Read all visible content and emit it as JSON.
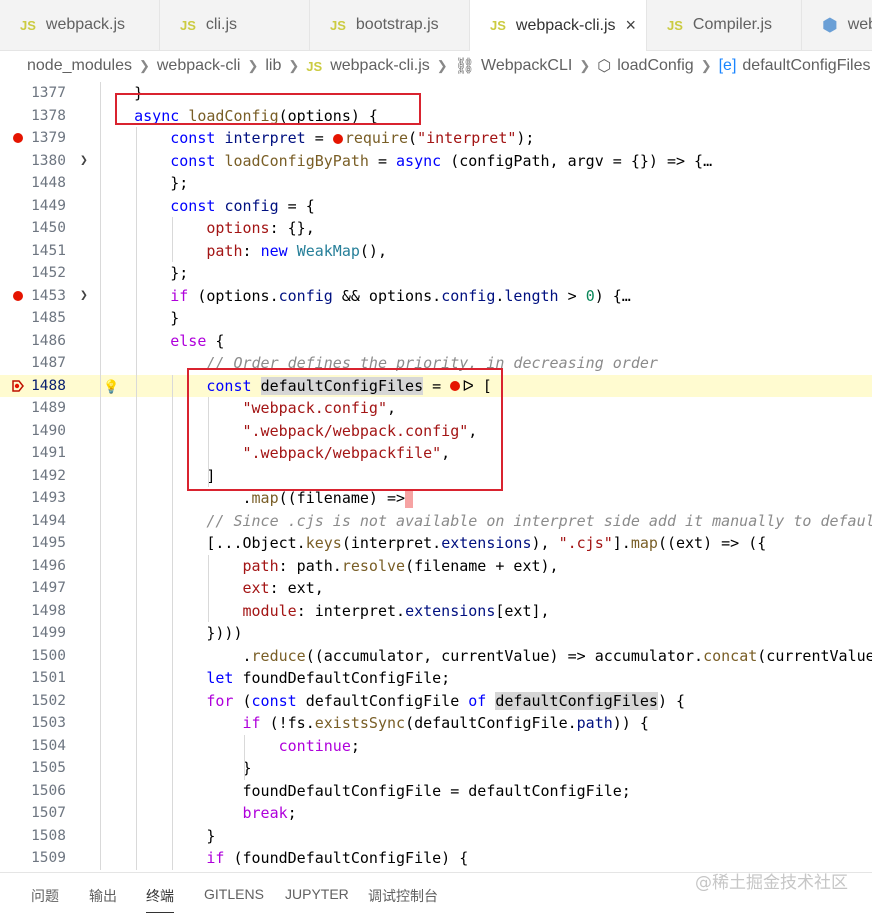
{
  "tabs": [
    {
      "icon": "JS",
      "label": "webpack.js"
    },
    {
      "icon": "JS",
      "label": "cli.js"
    },
    {
      "icon": "JS",
      "label": "bootstrap.js"
    },
    {
      "icon": "JS",
      "label": "webpack-cli.js",
      "active": true
    },
    {
      "icon": "JS",
      "label": "Compiler.js"
    },
    {
      "icon": "hex",
      "label": "webp"
    }
  ],
  "breadcrumb": [
    "node_modules",
    "webpack-cli",
    "lib",
    "webpack-cli.js",
    "WebpackCLI",
    "loadConfig",
    "defaultConfigFiles"
  ],
  "lines": [
    {
      "n": "1377",
      "tokens": [
        [
          "p",
          "    }"
        ]
      ]
    },
    {
      "n": "1378",
      "tokens": [
        [
          "k",
          "    async "
        ],
        [
          "f",
          "loadConfig"
        ],
        [
          "p",
          "(options) {"
        ]
      ]
    },
    {
      "n": "1379",
      "bp": true,
      "tokens": [
        [
          "k",
          "        const "
        ],
        [
          "v",
          "interpret"
        ],
        [
          "p",
          " = "
        ],
        [
          "bp",
          ""
        ],
        [
          "f",
          "require"
        ],
        [
          "p",
          "("
        ],
        [
          "s",
          "\"interpret\""
        ],
        [
          "p",
          ");"
        ]
      ]
    },
    {
      "n": "1380",
      "fold": true,
      "tokens": [
        [
          "k",
          "        const "
        ],
        [
          "f",
          "loadConfigByPath"
        ],
        [
          "p",
          " = "
        ],
        [
          "k",
          "async"
        ],
        [
          "p",
          " (configPath, argv = {}) => {…"
        ]
      ]
    },
    {
      "n": "1448",
      "tokens": [
        [
          "p",
          "        };"
        ]
      ]
    },
    {
      "n": "1449",
      "tokens": [
        [
          "k",
          "        const "
        ],
        [
          "v",
          "config"
        ],
        [
          "p",
          " = {"
        ]
      ]
    },
    {
      "n": "1450",
      "tokens": [
        [
          "s",
          "            options"
        ],
        [
          "p",
          ": {},"
        ]
      ]
    },
    {
      "n": "1451",
      "tokens": [
        [
          "s",
          "            path"
        ],
        [
          "p",
          ": "
        ],
        [
          "k",
          "new "
        ],
        [
          "t",
          "WeakMap"
        ],
        [
          "p",
          "(),"
        ]
      ]
    },
    {
      "n": "1452",
      "tokens": [
        [
          "p",
          "        };"
        ]
      ]
    },
    {
      "n": "1453",
      "bp": true,
      "fold": true,
      "tokens": [
        [
          "c",
          "        if"
        ],
        [
          "p",
          " (options."
        ],
        [
          "v",
          "config"
        ],
        [
          "p",
          " && options."
        ],
        [
          "v",
          "config"
        ],
        [
          "p",
          "."
        ],
        [
          "v",
          "length"
        ],
        [
          "p",
          " > "
        ],
        [
          "n",
          "0"
        ],
        [
          "p",
          ") {…"
        ]
      ]
    },
    {
      "n": "1485",
      "tokens": [
        [
          "p",
          "        }"
        ]
      ]
    },
    {
      "n": "1486",
      "tokens": [
        [
          "c",
          "        else"
        ],
        [
          "p",
          " {"
        ]
      ]
    },
    {
      "n": "1487",
      "tokens": [
        [
          "cm",
          "            // Order defines the priority, in decreasing order"
        ]
      ]
    },
    {
      "n": "1488",
      "current": true,
      "bulb": true,
      "tokens": [
        [
          "k",
          "            const "
        ],
        [
          "sel",
          "defaultConfigFiles"
        ],
        [
          "p",
          " = "
        ],
        [
          "bp",
          ""
        ],
        [
          "p",
          "ᐅ ["
        ]
      ]
    },
    {
      "n": "1489",
      "tokens": [
        [
          "s",
          "                \"webpack.config\""
        ],
        [
          "p",
          ","
        ]
      ]
    },
    {
      "n": "1490",
      "tokens": [
        [
          "s",
          "                \".webpack/webpack.config\""
        ],
        [
          "p",
          ","
        ]
      ]
    },
    {
      "n": "1491",
      "tokens": [
        [
          "s",
          "                \".webpack/webpackfile\""
        ],
        [
          "p",
          ","
        ]
      ]
    },
    {
      "n": "1492",
      "tokens": [
        [
          "p",
          "            ]"
        ]
      ]
    },
    {
      "n": "1493",
      "tokens": [
        [
          "p",
          "                ."
        ],
        [
          "f",
          "map"
        ],
        [
          "p",
          "((filename) =>"
        ],
        [
          "cur",
          ""
        ]
      ]
    },
    {
      "n": "1494",
      "tokens": [
        [
          "cm",
          "            // Since .cjs is not available on interpret side add it manually to default"
        ]
      ]
    },
    {
      "n": "1495",
      "tokens": [
        [
          "p",
          "            [...Object."
        ],
        [
          "f",
          "keys"
        ],
        [
          "p",
          "(interpret."
        ],
        [
          "v",
          "extensions"
        ],
        [
          "p",
          "), "
        ],
        [
          "s",
          "\".cjs\""
        ],
        [
          "p",
          "]."
        ],
        [
          "f",
          "map"
        ],
        [
          "p",
          "((ext) => ({"
        ]
      ]
    },
    {
      "n": "1496",
      "tokens": [
        [
          "s",
          "                path"
        ],
        [
          "p",
          ": path."
        ],
        [
          "f",
          "resolve"
        ],
        [
          "p",
          "(filename + ext),"
        ]
      ]
    },
    {
      "n": "1497",
      "tokens": [
        [
          "s",
          "                ext"
        ],
        [
          "p",
          ": ext,"
        ]
      ]
    },
    {
      "n": "1498",
      "tokens": [
        [
          "s",
          "                module"
        ],
        [
          "p",
          ": interpret."
        ],
        [
          "v",
          "extensions"
        ],
        [
          "p",
          "[ext],"
        ]
      ]
    },
    {
      "n": "1499",
      "tokens": [
        [
          "p",
          "            })))"
        ]
      ]
    },
    {
      "n": "1500",
      "tokens": [
        [
          "p",
          "                ."
        ],
        [
          "f",
          "reduce"
        ],
        [
          "p",
          "((accumulator, currentValue) => accumulator."
        ],
        [
          "f",
          "concat"
        ],
        [
          "p",
          "(currentValue)"
        ]
      ]
    },
    {
      "n": "1501",
      "tokens": [
        [
          "k",
          "            let "
        ],
        [
          "p",
          "foundDefaultConfigFile;"
        ]
      ]
    },
    {
      "n": "1502",
      "tokens": [
        [
          "c",
          "            for"
        ],
        [
          "p",
          " ("
        ],
        [
          "k",
          "const "
        ],
        [
          "p",
          "defaultConfigFile "
        ],
        [
          "k",
          "of "
        ],
        [
          "sel",
          "defaultConfigFiles"
        ],
        [
          "p",
          ") {"
        ]
      ]
    },
    {
      "n": "1503",
      "tokens": [
        [
          "c",
          "                if"
        ],
        [
          "p",
          " (!fs."
        ],
        [
          "f",
          "existsSync"
        ],
        [
          "p",
          "(defaultConfigFile."
        ],
        [
          "v",
          "path"
        ],
        [
          "p",
          ")) {"
        ]
      ]
    },
    {
      "n": "1504",
      "tokens": [
        [
          "c",
          "                    continue"
        ],
        [
          "p",
          ";"
        ]
      ]
    },
    {
      "n": "1505",
      "tokens": [
        [
          "p",
          "                }"
        ]
      ]
    },
    {
      "n": "1506",
      "tokens": [
        [
          "p",
          "                foundDefaultConfigFile = defaultConfigFile;"
        ]
      ]
    },
    {
      "n": "1507",
      "tokens": [
        [
          "c",
          "                break"
        ],
        [
          "p",
          ";"
        ]
      ]
    },
    {
      "n": "1508",
      "tokens": [
        [
          "p",
          "            }"
        ]
      ]
    },
    {
      "n": "1509",
      "tokens": [
        [
          "c",
          "            if"
        ],
        [
          "p",
          " (foundDefaultConfigFile) {"
        ]
      ]
    }
  ],
  "panel_tabs": [
    "问题",
    "输出",
    "终端",
    "GITLENS",
    "JUPYTER",
    "调试控制台"
  ],
  "panel_active": 2,
  "watermark": "@稀土掘金技术社区",
  "colors": {
    "breakpoint": "#e51400",
    "annotation_box": "#d9232f",
    "current_line": "#fffbd0"
  }
}
